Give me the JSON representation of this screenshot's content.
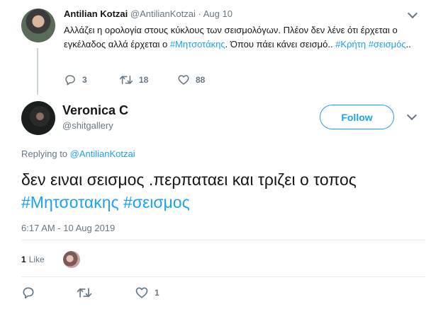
{
  "parent_tweet": {
    "name": "Antilian Kotzai",
    "handle": "@AntilianKotzai",
    "separator": "·",
    "date": "Aug 10",
    "text_1": "Αλλάζει η ορολογία στους κύκλους των σεισμολόγων. Πλέον δεν λένε ότι έρχεται ο εγκέλαδος αλλά έρχεται ο ",
    "hashtag_1": "#Μητσοτάκης",
    "text_2": ". Όπου πάει κάνει σεισμό.. ",
    "hashtag_2": "#Κρήτη",
    "text_3": " ",
    "hashtag_3": "#σεισμός",
    "text_4": "..",
    "replies": "3",
    "retweets": "18",
    "likes": "88"
  },
  "main_tweet": {
    "name": "Veronica C",
    "handle": "@shitgallery",
    "follow_label": "Follow",
    "replying_prefix": "Replying to ",
    "replying_to": "@AntilianKotzai",
    "text_1": "δεν ειναι σεισμος .περπαταει και τριζει ο τοπος ",
    "hashtag_1": "#Μητσοτακης",
    "text_2": " ",
    "hashtag_2": "#σεισμος",
    "timestamp": "6:17 AM - 10 Aug 2019",
    "like_count": "1",
    "like_label": "Like",
    "action_likes": "1"
  },
  "colors": {
    "accent": "#1da1f2",
    "secondary_text": "#657786",
    "divider": "#e6ecf0"
  },
  "icons": [
    "reply-icon",
    "retweet-icon",
    "heart-icon",
    "chevron-down-icon"
  ]
}
